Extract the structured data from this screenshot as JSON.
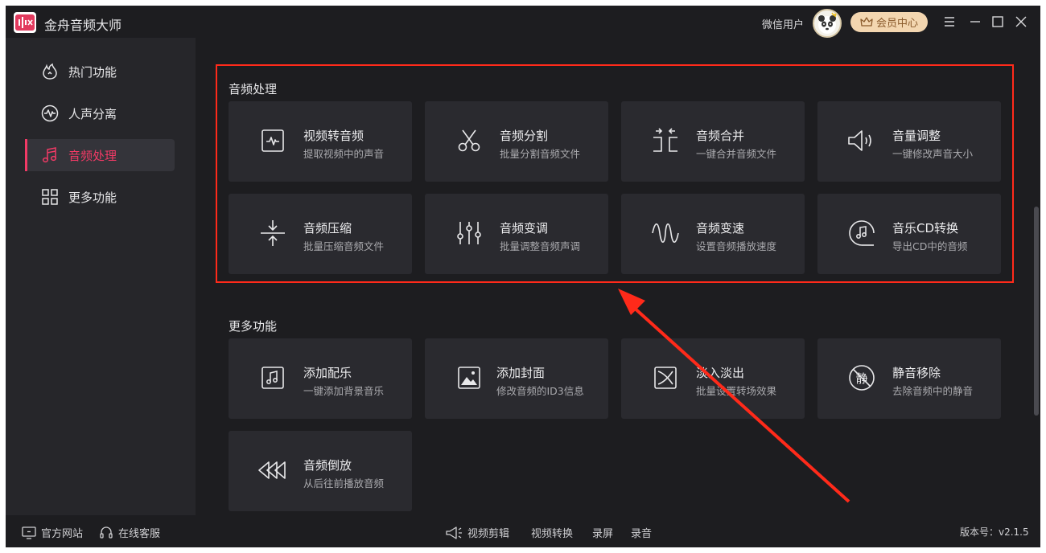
{
  "window": {
    "title": "金舟音频大师",
    "user_name": "微信用户",
    "vip_label": "会员中心"
  },
  "sidebar": {
    "items": [
      {
        "label": "热门功能",
        "icon": "fire-icon",
        "active": false
      },
      {
        "label": "人声分离",
        "icon": "waveform-circle-icon",
        "active": false
      },
      {
        "label": "音频处理",
        "icon": "music-note-icon",
        "active": true
      },
      {
        "label": "更多功能",
        "icon": "grid-icon",
        "active": false
      }
    ]
  },
  "audio_section": {
    "title": "音频处理",
    "cards": [
      {
        "title": "视频转音频",
        "subtitle": "提取视频中的声音",
        "icon": "video-to-audio-icon"
      },
      {
        "title": "音频分割",
        "subtitle": "批量分割音频文件",
        "icon": "scissors-icon"
      },
      {
        "title": "音频合并",
        "subtitle": "一键合并音频文件",
        "icon": "merge-icon"
      },
      {
        "title": "音量调整",
        "subtitle": "一键修改声音大小",
        "icon": "speaker-icon"
      },
      {
        "title": "音频压缩",
        "subtitle": "批量压缩音频文件",
        "icon": "compress-icon"
      },
      {
        "title": "音频变调",
        "subtitle": "批量调整音频声调",
        "icon": "sliders-icon"
      },
      {
        "title": "音频变速",
        "subtitle": "设置音频播放速度",
        "icon": "wave-icon"
      },
      {
        "title": "音乐CD转换",
        "subtitle": "导出CD中的音频",
        "icon": "cd-icon"
      }
    ]
  },
  "more_section": {
    "title": "更多功能",
    "cards": [
      {
        "title": "添加配乐",
        "subtitle": "一键添加背景音乐",
        "icon": "music-file-icon"
      },
      {
        "title": "添加封面",
        "subtitle": "修改音频的ID3信息",
        "icon": "image-icon"
      },
      {
        "title": "淡入淡出",
        "subtitle": "批量设置转场效果",
        "icon": "fade-icon"
      },
      {
        "title": "静音移除",
        "subtitle": "去除音频中的静音",
        "icon": "mute-icon"
      },
      {
        "title": "音频倒放",
        "subtitle": "从后往前播放音频",
        "icon": "rewind-icon"
      }
    ]
  },
  "footer": {
    "website": "官方网站",
    "support": "在线客服",
    "links": [
      "视频剪辑",
      "视频转换",
      "录屏",
      "录音"
    ],
    "version": "版本号：v2.1.5"
  },
  "colors": {
    "accent": "#f23a66",
    "annotation": "#ff2a1a",
    "background": "#1d1d20",
    "sidebar": "#26262a",
    "card": "#2a2a2f"
  }
}
